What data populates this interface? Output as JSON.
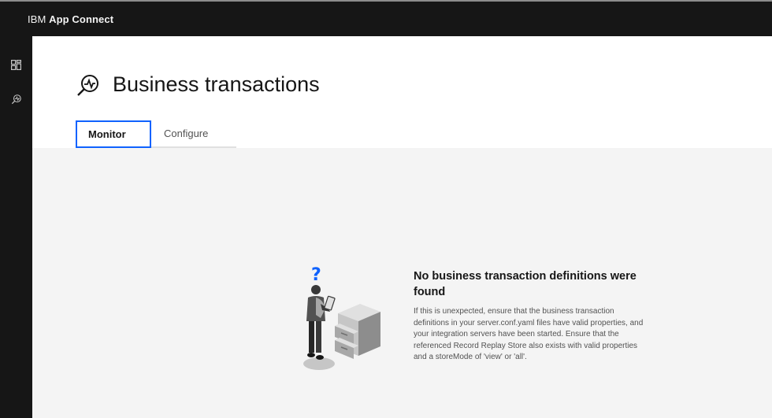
{
  "app": {
    "brand_prefix": "IBM",
    "brand_name": "App Connect"
  },
  "sidenav": {
    "items": [
      {
        "icon": "dashboard-icon"
      },
      {
        "icon": "business-transactions-icon"
      }
    ]
  },
  "page": {
    "title": "Business transactions",
    "title_icon": "business-transactions-icon"
  },
  "tabs": [
    {
      "label": "Monitor",
      "selected": true
    },
    {
      "label": "Configure",
      "selected": false
    }
  ],
  "empty_state": {
    "illustration": "person-with-tablet-and-cabinet",
    "question_mark": "?",
    "title": "No business transaction definitions were found",
    "body": "If this is unexpected, ensure that the business transaction definitions in your server.conf.yaml files have valid properties, and your integration servers have been started. Ensure that the referenced Record Replay Store also exists with valid properties and a storeMode of 'view' or 'all'."
  },
  "colors": {
    "header_bg": "#161616",
    "accent": "#0f62fe",
    "content_bg": "#f4f4f4"
  }
}
